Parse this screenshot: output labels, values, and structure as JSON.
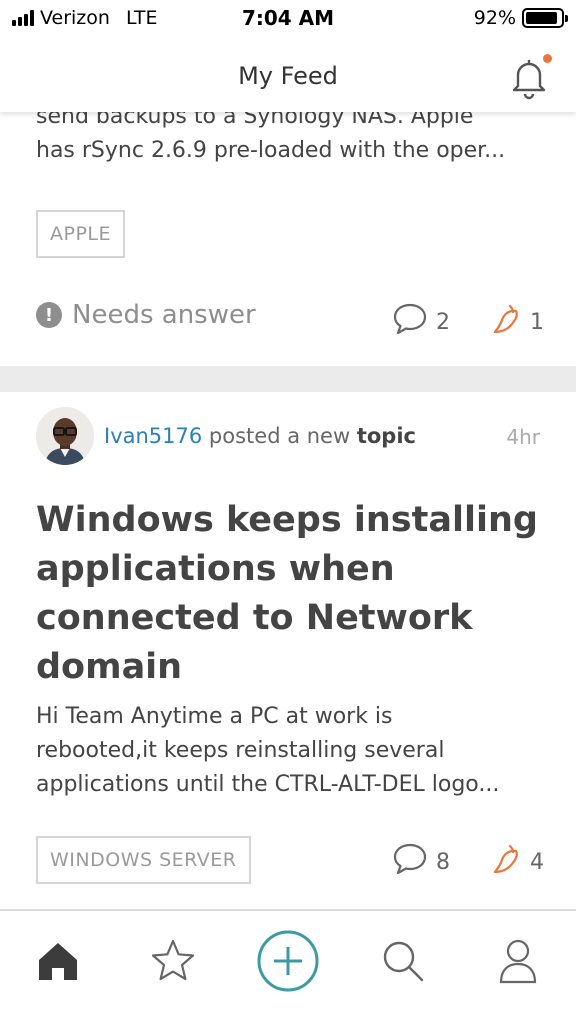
{
  "status_bar": {
    "carrier": "Verizon",
    "network": "LTE",
    "time": "7:04 AM",
    "battery_text": "92%",
    "battery_level": 0.92
  },
  "header": {
    "title": "My Feed",
    "notification_icon": "bell-icon",
    "has_unread": true,
    "accent_color": "#e8753a"
  },
  "feed": {
    "card1": {
      "snippet_lines": [
        "send backups to a Synology NAS. Apple",
        "has rSync 2.6.9 pre-loaded with the oper..."
      ],
      "tag": "APPLE",
      "status": "Needs answer",
      "comments": "2",
      "likes": "1"
    },
    "card2": {
      "username": "Ivan5176",
      "action_text": " posted a new ",
      "post_kind": "topic",
      "time_ago": "4hr",
      "title": "Windows keeps installing applications when connected to Network domain",
      "body_lines": [
        "Hi Team Anytime a PC at work is",
        "rebooted,it keeps reinstalling several",
        "applications until the CTRL-ALT-DEL logo..."
      ],
      "tag": "WINDOWS SERVER",
      "comments": "8",
      "likes": "4"
    }
  },
  "tabbar": {
    "items": [
      "home-icon",
      "star-icon",
      "add-icon",
      "search-icon",
      "profile-icon"
    ],
    "active": "home-icon",
    "accent_color": "#3a9ba0"
  }
}
